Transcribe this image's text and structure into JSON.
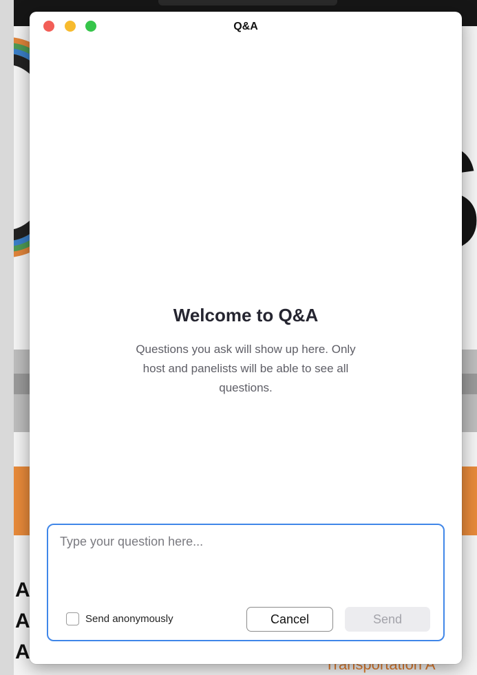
{
  "window": {
    "title": "Q&A",
    "traffic_lights": [
      "close",
      "minimize",
      "zoom"
    ]
  },
  "welcome": {
    "title": "Welcome to Q&A",
    "body": "Questions you ask will show up here. Only host and panelists will be able to see all questions."
  },
  "compose": {
    "placeholder": "Type your question here...",
    "value": "",
    "anonymous_label": "Send anonymously",
    "anonymous_checked": false,
    "cancel_label": "Cancel",
    "send_label": "Send",
    "send_enabled": false
  },
  "background": {
    "side_letters": [
      "A",
      "A",
      "A"
    ],
    "big_letter": "'S",
    "orange_text": "Transportation A"
  },
  "colors": {
    "close": "#f25e57",
    "minimize": "#f7bb2e",
    "zoom": "#36c54a",
    "focus_border": "#3f86e8",
    "orange_band": "#e88a3a"
  }
}
